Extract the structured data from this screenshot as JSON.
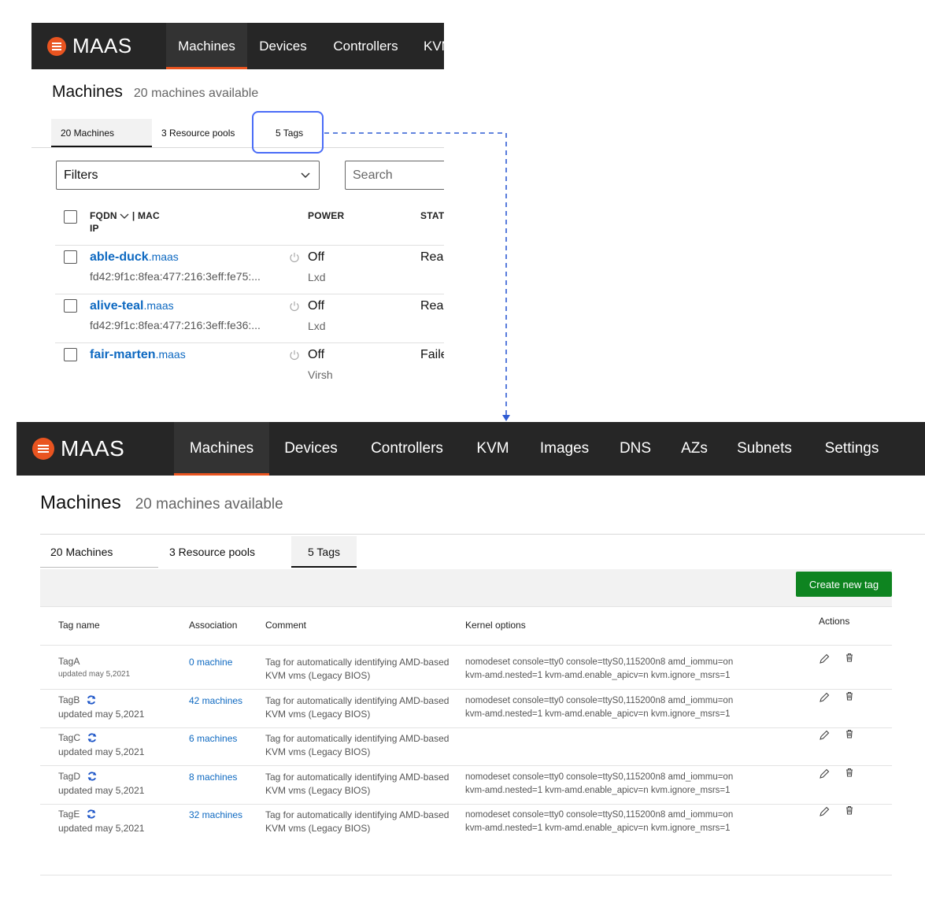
{
  "top": {
    "brand": "MAAS",
    "nav": [
      "Machines",
      "Devices",
      "Controllers",
      "KVM"
    ],
    "title": "Machines",
    "subtitle": "20 machines available",
    "tabs": [
      "20 Machines",
      "3 Resource pools",
      "5 Tags"
    ],
    "filters_label": "Filters",
    "search_placeholder": "Search",
    "columns": {
      "fqdn": "FQDN",
      "mac": "| MAC",
      "ip": "IP",
      "power": "POWER",
      "status": "STATU"
    },
    "machines": [
      {
        "name": "able-duck",
        "domain": ".maas",
        "mac": "fd42:9f1c:8fea:477:216:3eff:fe75:...",
        "power": "Off",
        "power_type": "Lxd",
        "status": "Read"
      },
      {
        "name": "alive-teal",
        "domain": ".maas",
        "mac": "fd42:9f1c:8fea:477:216:3eff:fe36:...",
        "power": "Off",
        "power_type": "Lxd",
        "status": "Read"
      },
      {
        "name": "fair-marten",
        "domain": ".maas",
        "mac": "",
        "power": "Off",
        "power_type": "Virsh",
        "status": "Faile"
      }
    ]
  },
  "bottom": {
    "brand": "MAAS",
    "nav": [
      "Machines",
      "Devices",
      "Controllers",
      "KVM",
      "Images",
      "DNS",
      "AZs",
      "Subnets",
      "Settings"
    ],
    "title": "Machines",
    "subtitle": "20 machines available",
    "tabs": [
      "20 Machines",
      "3 Resource pools",
      "5 Tags"
    ],
    "create_button": "Create new tag",
    "headers": {
      "tag_name": "Tag name",
      "association": "Association",
      "comment": "Comment",
      "kernel": "Kernel options",
      "actions": "Actions"
    },
    "tags": [
      {
        "name": "TagA",
        "updated": "updated may 5,2021",
        "association": "0 machine",
        "comment": "Tag for automatically identifying AMD-based KVM vms (Legacy BIOS)",
        "kernel1": "nomodeset console=tty0 console=ttyS0,115200n8 amd_iommu=on",
        "kernel2": "kvm-amd.nested=1 kvm-amd.enable_apicv=n kvm.ignore_msrs=1"
      },
      {
        "name": "TagB",
        "updated": "updated may 5,2021",
        "association": "42 machines",
        "comment": "Tag for automatically identifying AMD-based KVM vms (Legacy BIOS)",
        "kernel1": "nomodeset console=tty0 console=ttyS0,115200n8 amd_iommu=on",
        "kernel2": "kvm-amd.nested=1 kvm-amd.enable_apicv=n kvm.ignore_msrs=1"
      },
      {
        "name": "TagC",
        "updated": "updated may 5,2021",
        "association": "6 machines",
        "comment": "Tag for automatically identifying AMD-based KVM vms (Legacy BIOS)",
        "kernel1": "",
        "kernel2": ""
      },
      {
        "name": "TagD",
        "updated": "updated may 5,2021",
        "association": "8 machines",
        "comment": "Tag for automatically identifying AMD-based KVM vms (Legacy BIOS)",
        "kernel1": "nomodeset console=tty0 console=ttyS0,115200n8 amd_iommu=on",
        "kernel2": "kvm-amd.nested=1 kvm-amd.enable_apicv=n kvm.ignore_msrs=1"
      },
      {
        "name": "TagE",
        "updated": "updated may 5,2021",
        "association": "32 machines",
        "comment": "Tag for automatically identifying AMD-based KVM vms (Legacy BIOS)",
        "kernel1": "nomodeset console=tty0 console=ttyS0,115200n8 amd_iommu=on",
        "kernel2": "kvm-amd.nested=1 kvm-amd.enable_apicv=n kvm.ignore_msrs=1"
      }
    ]
  },
  "colors": {
    "brand_orange": "#e95420",
    "nav_bg": "#262626",
    "link_blue": "#0e69c1",
    "button_green": "#0e8420",
    "highlight_blue": "#4a6cf7"
  },
  "icons": [
    "menu-logo-icon",
    "chevron-down-icon",
    "power-icon",
    "sync-icon",
    "edit-icon",
    "delete-icon"
  ]
}
